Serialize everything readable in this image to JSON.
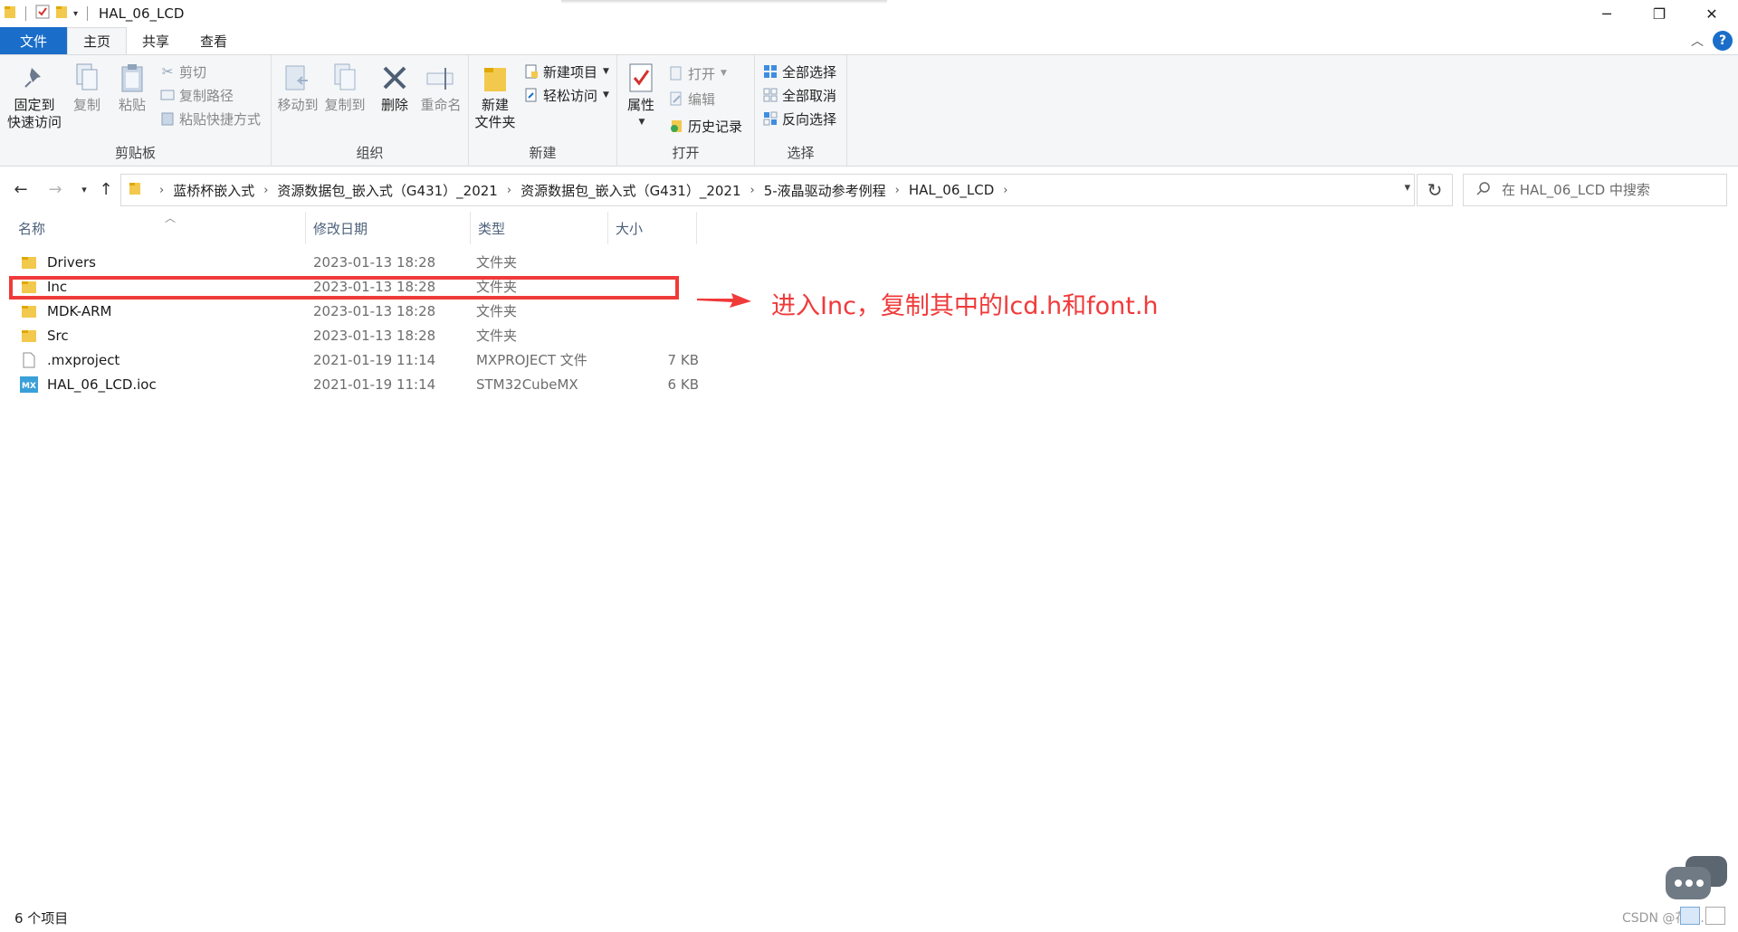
{
  "window": {
    "title": "HAL_06_LCD",
    "controls": {
      "minimize": "─",
      "maximize": "❐",
      "close": "✕"
    }
  },
  "tabs": [
    {
      "label": "文件"
    },
    {
      "label": "主页"
    },
    {
      "label": "共享"
    },
    {
      "label": "查看"
    }
  ],
  "ribbon": {
    "clipboard": {
      "group_label": "剪贴板",
      "pin_line1": "固定到",
      "pin_line2": "快速访问",
      "copy": "复制",
      "paste": "粘贴",
      "cut": "剪切",
      "copy_path": "复制路径",
      "paste_shortcut": "粘贴快捷方式"
    },
    "organize": {
      "group_label": "组织",
      "move_to": "移动到",
      "copy_to": "复制到",
      "delete": "删除",
      "rename": "重命名"
    },
    "new": {
      "group_label": "新建",
      "new_folder_line1": "新建",
      "new_folder_line2": "文件夹",
      "new_item": "新建项目",
      "easy_access": "轻松访问"
    },
    "open": {
      "group_label": "打开",
      "properties": "属性",
      "open": "打开",
      "edit": "编辑",
      "history": "历史记录"
    },
    "select": {
      "group_label": "选择",
      "select_all": "全部选择",
      "select_none": "全部取消",
      "invert": "反向选择"
    }
  },
  "breadcrumb": [
    "蓝桥杯嵌入式",
    "资源数据包_嵌入式（G431）_2021",
    "资源数据包_嵌入式（G431）_2021",
    "5-液晶驱动参考例程",
    "HAL_06_LCD"
  ],
  "search": {
    "placeholder": "在 HAL_06_LCD 中搜索"
  },
  "columns": {
    "name": "名称",
    "modified": "修改日期",
    "type": "类型",
    "size": "大小"
  },
  "files": [
    {
      "name": "Drivers",
      "modified": "2023-01-13 18:28",
      "type": "文件夹",
      "size": "",
      "icon": "folder-icon"
    },
    {
      "name": "Inc",
      "modified": "2023-01-13 18:28",
      "type": "文件夹",
      "size": "",
      "icon": "folder-icon"
    },
    {
      "name": "MDK-ARM",
      "modified": "2023-01-13 18:28",
      "type": "文件夹",
      "size": "",
      "icon": "folder-icon"
    },
    {
      "name": "Src",
      "modified": "2023-01-13 18:28",
      "type": "文件夹",
      "size": "",
      "icon": "folder-icon"
    },
    {
      "name": ".mxproject",
      "modified": "2021-01-19 11:14",
      "type": "MXPROJECT 文件",
      "size": "7 KB",
      "icon": "file-icon"
    },
    {
      "name": "HAL_06_LCD.ioc",
      "modified": "2021-01-19 11:14",
      "type": "STM32CubeMX",
      "size": "6 KB",
      "icon": "mx-icon"
    }
  ],
  "annotation": {
    "text": "进入Inc，复制其中的lcd.h和font.h",
    "color": "#f03a3a"
  },
  "status": {
    "count": "6 个项目"
  },
  "watermark": "CSDN @花花...",
  "colors": {
    "accent": "#1a6ec9",
    "folder": "#f2c94c",
    "annotation": "#f03a3a"
  }
}
